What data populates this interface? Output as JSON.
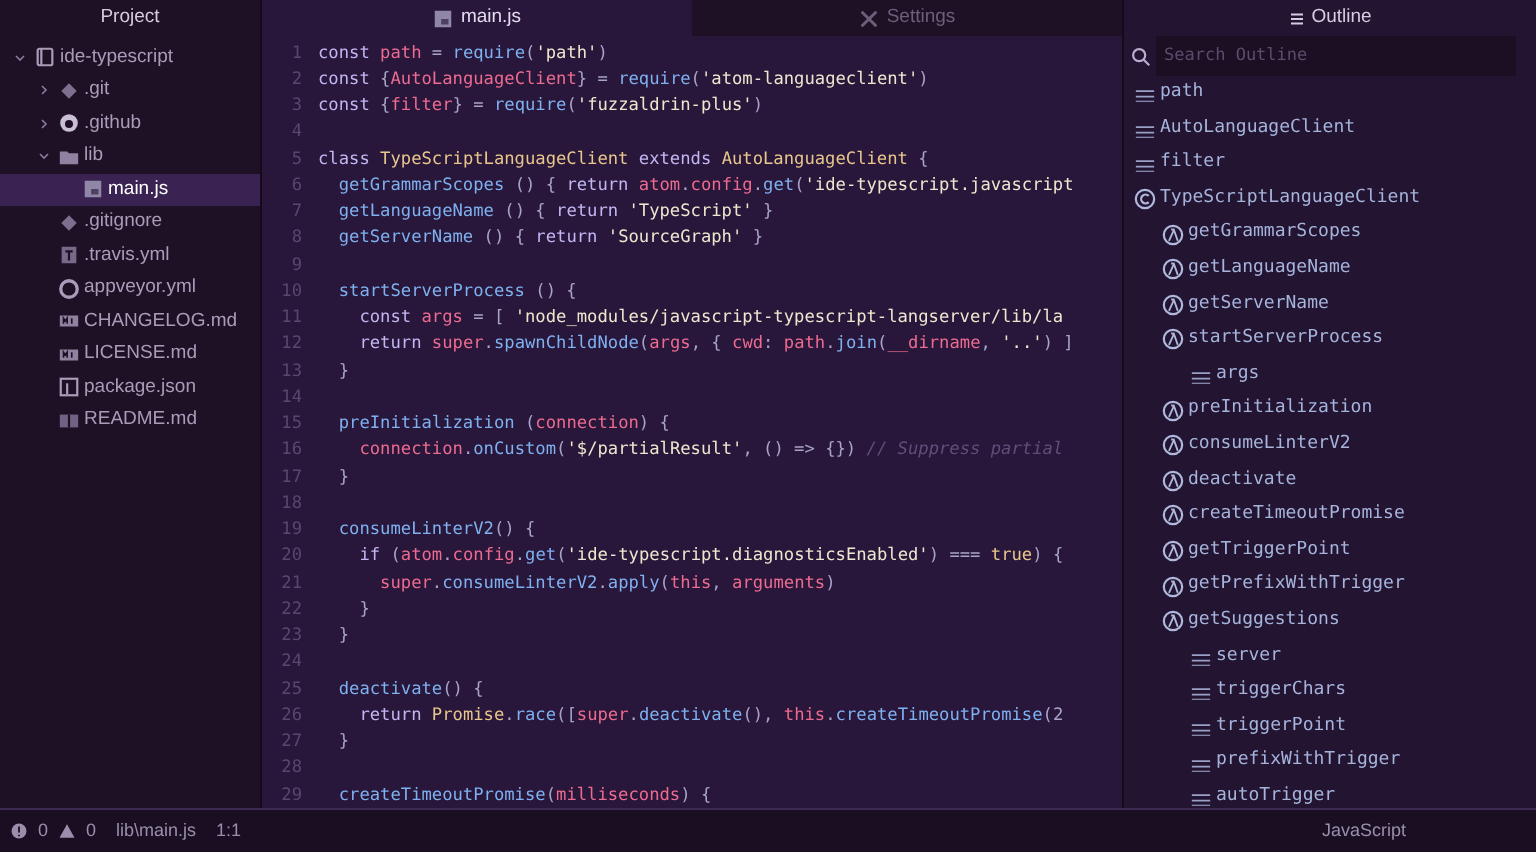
{
  "sidebar": {
    "title": "Project",
    "tree": [
      {
        "name": "ide-typescript",
        "kind": "repo",
        "expanded": true,
        "selected": false,
        "children": [
          {
            "name": ".git",
            "kind": "git",
            "expanded": false,
            "selected": false
          },
          {
            "name": ".github",
            "kind": "github",
            "expanded": false,
            "selected": false
          },
          {
            "name": "lib",
            "kind": "folder",
            "expanded": true,
            "selected": false,
            "children": [
              {
                "name": "main.js",
                "kind": "js",
                "selected": true
              }
            ]
          },
          {
            "name": ".gitignore",
            "kind": "git",
            "selected": false
          },
          {
            "name": ".travis.yml",
            "kind": "travis",
            "selected": false
          },
          {
            "name": "appveyor.yml",
            "kind": "appveyor",
            "selected": false
          },
          {
            "name": "CHANGELOG.md",
            "kind": "markdown",
            "selected": false
          },
          {
            "name": "LICENSE.md",
            "kind": "markdown",
            "selected": false
          },
          {
            "name": "package.json",
            "kind": "package",
            "selected": false
          },
          {
            "name": "README.md",
            "kind": "book",
            "selected": false
          }
        ]
      }
    ]
  },
  "tabs": [
    {
      "label": "main.js",
      "kind": "js",
      "selected": true
    },
    {
      "label": "Settings",
      "kind": "settings",
      "selected": false
    }
  ],
  "editor": {
    "lines": [
      {
        "number": "1",
        "tokens": [
          {
            "kind": "kw",
            "text": "const "
          },
          {
            "kind": "var",
            "text": "path"
          },
          {
            "kind": "pl",
            "text": " = "
          },
          {
            "kind": "fn",
            "text": "require"
          },
          {
            "kind": "pl",
            "text": "("
          },
          {
            "kind": "str",
            "text": "'path'"
          },
          {
            "kind": "pl",
            "text": ")"
          }
        ]
      },
      {
        "number": "2",
        "tokens": [
          {
            "kind": "kw",
            "text": "const "
          },
          {
            "kind": "pl",
            "text": "{"
          },
          {
            "kind": "var",
            "text": "AutoLanguageClient"
          },
          {
            "kind": "pl",
            "text": "} = "
          },
          {
            "kind": "fn",
            "text": "require"
          },
          {
            "kind": "pl",
            "text": "("
          },
          {
            "kind": "str",
            "text": "'atom-languageclient'"
          },
          {
            "kind": "pl",
            "text": ")"
          }
        ]
      },
      {
        "number": "3",
        "tokens": [
          {
            "kind": "kw",
            "text": "const "
          },
          {
            "kind": "pl",
            "text": "{"
          },
          {
            "kind": "var",
            "text": "filter"
          },
          {
            "kind": "pl",
            "text": "} = "
          },
          {
            "kind": "fn",
            "text": "require"
          },
          {
            "kind": "pl",
            "text": "("
          },
          {
            "kind": "str",
            "text": "'fuzzaldrin-plus'"
          },
          {
            "kind": "pl",
            "text": ")"
          }
        ]
      },
      {
        "number": "4"
      },
      {
        "number": "5",
        "tokens": [
          {
            "kind": "kw",
            "text": "class "
          },
          {
            "kind": "cls",
            "text": "TypeScriptLanguageClient "
          },
          {
            "kind": "kw",
            "text": "extends "
          },
          {
            "kind": "cls",
            "text": "AutoLanguageClient "
          },
          {
            "kind": "pl",
            "text": "{"
          }
        ]
      },
      {
        "number": "6",
        "tokens": [
          {
            "kind": "fn",
            "text": "  getGrammarScopes "
          },
          {
            "kind": "pl",
            "text": "() { "
          },
          {
            "kind": "kw",
            "text": "return "
          },
          {
            "kind": "var",
            "text": "atom"
          },
          {
            "kind": "pl",
            "text": "."
          },
          {
            "kind": "var",
            "text": "config"
          },
          {
            "kind": "pl",
            "text": "."
          },
          {
            "kind": "fn",
            "text": "get"
          },
          {
            "kind": "pl",
            "text": "("
          },
          {
            "kind": "str",
            "text": "'ide-typescript.javascript"
          }
        ]
      },
      {
        "number": "7",
        "tokens": [
          {
            "kind": "fn",
            "text": "  getLanguageName "
          },
          {
            "kind": "pl",
            "text": "() { "
          },
          {
            "kind": "kw",
            "text": "return "
          },
          {
            "kind": "str",
            "text": "'TypeScript'"
          },
          {
            "kind": "pl",
            "text": " }"
          }
        ]
      },
      {
        "number": "8",
        "tokens": [
          {
            "kind": "fn",
            "text": "  getServerName "
          },
          {
            "kind": "pl",
            "text": "() { "
          },
          {
            "kind": "kw",
            "text": "return "
          },
          {
            "kind": "str",
            "text": "'SourceGraph'"
          },
          {
            "kind": "pl",
            "text": " }"
          }
        ]
      },
      {
        "number": "9"
      },
      {
        "number": "10",
        "tokens": [
          {
            "kind": "fn",
            "text": "  startServerProcess "
          },
          {
            "kind": "pl",
            "text": "() {"
          }
        ]
      },
      {
        "number": "11",
        "tokens": [
          {
            "kind": "kw",
            "text": "    const "
          },
          {
            "kind": "var",
            "text": "args"
          },
          {
            "kind": "pl",
            "text": " = [ "
          },
          {
            "kind": "str",
            "text": "'node_modules/javascript-typescript-langserver/lib/la"
          }
        ]
      },
      {
        "number": "12",
        "tokens": [
          {
            "kind": "kw",
            "text": "    return "
          },
          {
            "kind": "var",
            "text": "super"
          },
          {
            "kind": "pl",
            "text": "."
          },
          {
            "kind": "fn",
            "text": "spawnChildNode"
          },
          {
            "kind": "pl",
            "text": "("
          },
          {
            "kind": "var",
            "text": "args"
          },
          {
            "kind": "pl",
            "text": ", { "
          },
          {
            "kind": "var",
            "text": "cwd"
          },
          {
            "kind": "pl",
            "text": ": "
          },
          {
            "kind": "var",
            "text": "path"
          },
          {
            "kind": "pl",
            "text": "."
          },
          {
            "kind": "fn",
            "text": "join"
          },
          {
            "kind": "pl",
            "text": "("
          },
          {
            "kind": "var",
            "text": "__dirname"
          },
          {
            "kind": "pl",
            "text": ", "
          },
          {
            "kind": "str",
            "text": "'..'"
          },
          {
            "kind": "pl",
            "text": ") ]"
          }
        ]
      },
      {
        "number": "13",
        "tokens": [
          {
            "kind": "pl",
            "text": "  }"
          }
        ]
      },
      {
        "number": "14"
      },
      {
        "number": "15",
        "tokens": [
          {
            "kind": "fn",
            "text": "  preInitialization "
          },
          {
            "kind": "pl",
            "text": "("
          },
          {
            "kind": "var",
            "text": "connection"
          },
          {
            "kind": "pl",
            "text": ") {"
          }
        ]
      },
      {
        "number": "16",
        "tokens": [
          {
            "kind": "var",
            "text": "    connection"
          },
          {
            "kind": "pl",
            "text": "."
          },
          {
            "kind": "fn",
            "text": "onCustom"
          },
          {
            "kind": "pl",
            "text": "("
          },
          {
            "kind": "str",
            "text": "'$/partialResult'"
          },
          {
            "kind": "pl",
            "text": ", () => {}) "
          },
          {
            "kind": "cm",
            "text": "// Suppress partial"
          }
        ]
      },
      {
        "number": "17",
        "tokens": [
          {
            "kind": "pl",
            "text": "  }"
          }
        ]
      },
      {
        "number": "18"
      },
      {
        "number": "19",
        "tokens": [
          {
            "kind": "fn",
            "text": "  consumeLinterV2"
          },
          {
            "kind": "pl",
            "text": "() {"
          }
        ]
      },
      {
        "number": "20",
        "tokens": [
          {
            "kind": "kw",
            "text": "    if "
          },
          {
            "kind": "pl",
            "text": "("
          },
          {
            "kind": "var",
            "text": "atom"
          },
          {
            "kind": "pl",
            "text": "."
          },
          {
            "kind": "var",
            "text": "config"
          },
          {
            "kind": "pl",
            "text": "."
          },
          {
            "kind": "fn",
            "text": "get"
          },
          {
            "kind": "pl",
            "text": "("
          },
          {
            "kind": "str",
            "text": "'ide-typescript.diagnosticsEnabled'"
          },
          {
            "kind": "pl",
            "text": ") === "
          },
          {
            "kind": "cls",
            "text": "true"
          },
          {
            "kind": "pl",
            "text": ") {"
          }
        ]
      },
      {
        "number": "21",
        "tokens": [
          {
            "kind": "var",
            "text": "      super"
          },
          {
            "kind": "pl",
            "text": "."
          },
          {
            "kind": "fn",
            "text": "consumeLinterV2"
          },
          {
            "kind": "pl",
            "text": "."
          },
          {
            "kind": "fn",
            "text": "apply"
          },
          {
            "kind": "pl",
            "text": "("
          },
          {
            "kind": "var",
            "text": "this"
          },
          {
            "kind": "pl",
            "text": ", "
          },
          {
            "kind": "var",
            "text": "arguments"
          },
          {
            "kind": "pl",
            "text": ")"
          }
        ]
      },
      {
        "number": "22",
        "tokens": [
          {
            "kind": "pl",
            "text": "    }"
          }
        ]
      },
      {
        "number": "23",
        "tokens": [
          {
            "kind": "pl",
            "text": "  }"
          }
        ]
      },
      {
        "number": "24"
      },
      {
        "number": "25",
        "tokens": [
          {
            "kind": "fn",
            "text": "  deactivate"
          },
          {
            "kind": "pl",
            "text": "() {"
          }
        ]
      },
      {
        "number": "26",
        "tokens": [
          {
            "kind": "kw",
            "text": "    return "
          },
          {
            "kind": "cls",
            "text": "Promise"
          },
          {
            "kind": "pl",
            "text": "."
          },
          {
            "kind": "fn",
            "text": "race"
          },
          {
            "kind": "pl",
            "text": "(["
          },
          {
            "kind": "var",
            "text": "super"
          },
          {
            "kind": "pl",
            "text": "."
          },
          {
            "kind": "fn",
            "text": "deactivate"
          },
          {
            "kind": "pl",
            "text": "(), "
          },
          {
            "kind": "var",
            "text": "this"
          },
          {
            "kind": "pl",
            "text": "."
          },
          {
            "kind": "fn",
            "text": "createTimeoutPromise"
          },
          {
            "kind": "pl",
            "text": "(2"
          }
        ]
      },
      {
        "number": "27",
        "tokens": [
          {
            "kind": "pl",
            "text": "  }"
          }
        ]
      },
      {
        "number": "28"
      },
      {
        "number": "29",
        "tokens": [
          {
            "kind": "fn",
            "text": "  createTimeoutPromise"
          },
          {
            "kind": "pl",
            "text": "("
          },
          {
            "kind": "var",
            "text": "milliseconds"
          },
          {
            "kind": "pl",
            "text": ") {"
          }
        ]
      }
    ]
  },
  "outline": {
    "title": "Outline",
    "search": {
      "placeholder": "Search Outline"
    },
    "items": [
      {
        "name": "path",
        "kind": "variable"
      },
      {
        "name": "AutoLanguageClient",
        "kind": "variable"
      },
      {
        "name": "filter",
        "kind": "variable"
      },
      {
        "name": "TypeScriptLanguageClient",
        "kind": "class",
        "children": [
          {
            "name": "getGrammarScopes",
            "kind": "method"
          },
          {
            "name": "getLanguageName",
            "kind": "method"
          },
          {
            "name": "getServerName",
            "kind": "method"
          },
          {
            "name": "startServerProcess",
            "kind": "method",
            "children": [
              {
                "name": "args",
                "kind": "variable"
              }
            ]
          },
          {
            "name": "preInitialization",
            "kind": "method"
          },
          {
            "name": "consumeLinterV2",
            "kind": "method"
          },
          {
            "name": "deactivate",
            "kind": "method"
          },
          {
            "name": "createTimeoutPromise",
            "kind": "method"
          },
          {
            "name": "getTriggerPoint",
            "kind": "method"
          },
          {
            "name": "getPrefixWithTrigger",
            "kind": "method"
          },
          {
            "name": "getSuggestions",
            "kind": "method",
            "children": [
              {
                "name": "server",
                "kind": "variable"
              },
              {
                "name": "triggerChars",
                "kind": "variable"
              },
              {
                "name": "triggerPoint",
                "kind": "variable"
              },
              {
                "name": "prefixWithTrigger",
                "kind": "variable"
              },
              {
                "name": "autoTrigger",
                "kind": "variable"
              }
            ]
          }
        ]
      }
    ]
  },
  "status_bar": {
    "errors": "0",
    "warnings": "0",
    "file": "lib\\main.js",
    "position": "1:1",
    "grammar": "JavaScript"
  }
}
